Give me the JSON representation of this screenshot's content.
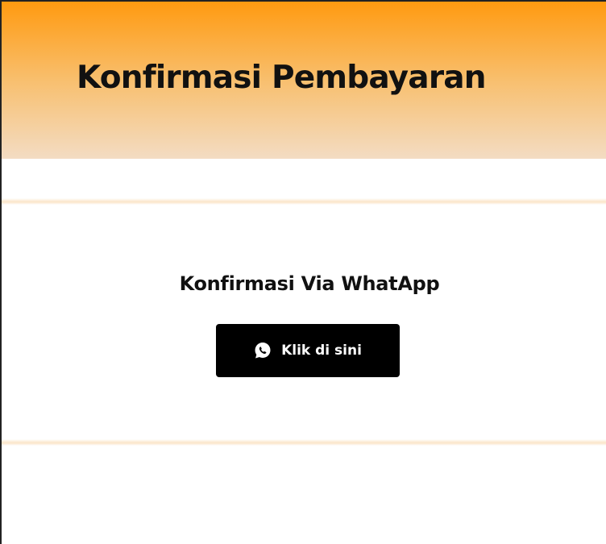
{
  "header": {
    "title": "Konfirmasi Pembayaran"
  },
  "confirmation": {
    "heading": "Konfirmasi Via WhatApp",
    "button_label": "Klik di sini",
    "button_icon": "whatsapp-icon"
  },
  "colors": {
    "header_gradient_top": "#ff9a10",
    "header_gradient_bottom": "#f3dcc3",
    "button_background": "#000000",
    "button_text": "#ffffff"
  }
}
